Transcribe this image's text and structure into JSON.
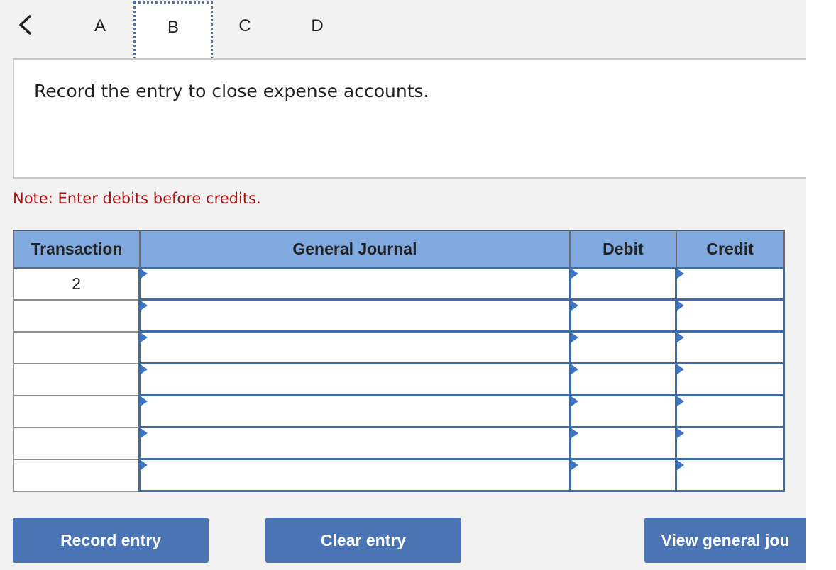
{
  "tabs": {
    "back_symbol": "<",
    "items": [
      "A",
      "B",
      "C",
      "D"
    ],
    "active": "B"
  },
  "question": {
    "text": "Record the entry to close expense accounts."
  },
  "note": "Note: Enter debits before credits.",
  "table": {
    "headers": {
      "transaction": "Transaction",
      "journal": "General Journal",
      "debit": "Debit",
      "credit": "Credit"
    },
    "rows": [
      {
        "transaction": "2",
        "journal": "",
        "debit": "",
        "credit": ""
      },
      {
        "transaction": "",
        "journal": "",
        "debit": "",
        "credit": ""
      },
      {
        "transaction": "",
        "journal": "",
        "debit": "",
        "credit": ""
      },
      {
        "transaction": "",
        "journal": "",
        "debit": "",
        "credit": ""
      },
      {
        "transaction": "",
        "journal": "",
        "debit": "",
        "credit": ""
      },
      {
        "transaction": "",
        "journal": "",
        "debit": "",
        "credit": ""
      },
      {
        "transaction": "",
        "journal": "",
        "debit": "",
        "credit": ""
      }
    ]
  },
  "buttons": {
    "record": "Record entry",
    "clear": "Clear entry",
    "view": "View general jou"
  },
  "colors": {
    "accent": "#4a74b4",
    "header_bg": "#80aadf",
    "note": "#a31515"
  }
}
